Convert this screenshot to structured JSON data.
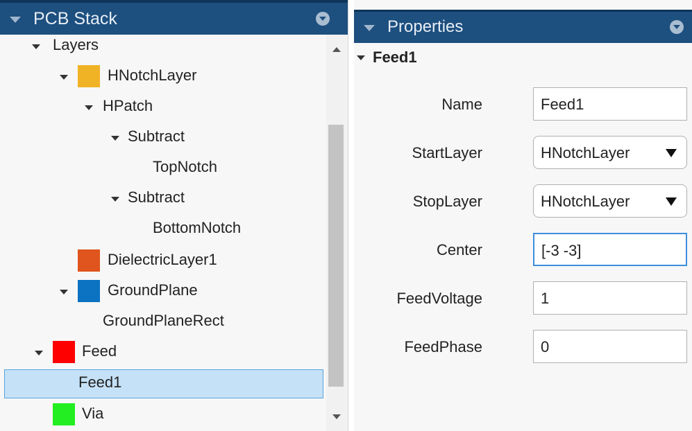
{
  "pcb_panel": {
    "title": "PCB Stack",
    "rows": [
      {
        "label": "Layers"
      },
      {
        "label": "HNotchLayer",
        "swatch": "#f0b325"
      },
      {
        "label": "HPatch"
      },
      {
        "label": "Subtract"
      },
      {
        "label": "TopNotch"
      },
      {
        "label": "Subtract"
      },
      {
        "label": "BottomNotch"
      },
      {
        "label": "DielectricLayer1",
        "swatch": "#e0541e"
      },
      {
        "label": "GroundPlane",
        "swatch": "#0c72c2"
      },
      {
        "label": "GroundPlaneRect"
      },
      {
        "label": "Feed",
        "swatch": "#ff0000"
      },
      {
        "label": "Feed1"
      },
      {
        "label": "Via",
        "swatch": "#22ee22"
      }
    ]
  },
  "props_panel": {
    "title": "Properties",
    "section": "Feed1",
    "fields": [
      {
        "label": "Name",
        "value": "Feed1"
      },
      {
        "label": "StartLayer",
        "value": "HNotchLayer"
      },
      {
        "label": "StopLayer",
        "value": "HNotchLayer"
      },
      {
        "label": "Center",
        "value": "[-3 -3]"
      },
      {
        "label": "FeedVoltage",
        "value": "1"
      },
      {
        "label": "FeedPhase",
        "value": "0"
      }
    ]
  }
}
